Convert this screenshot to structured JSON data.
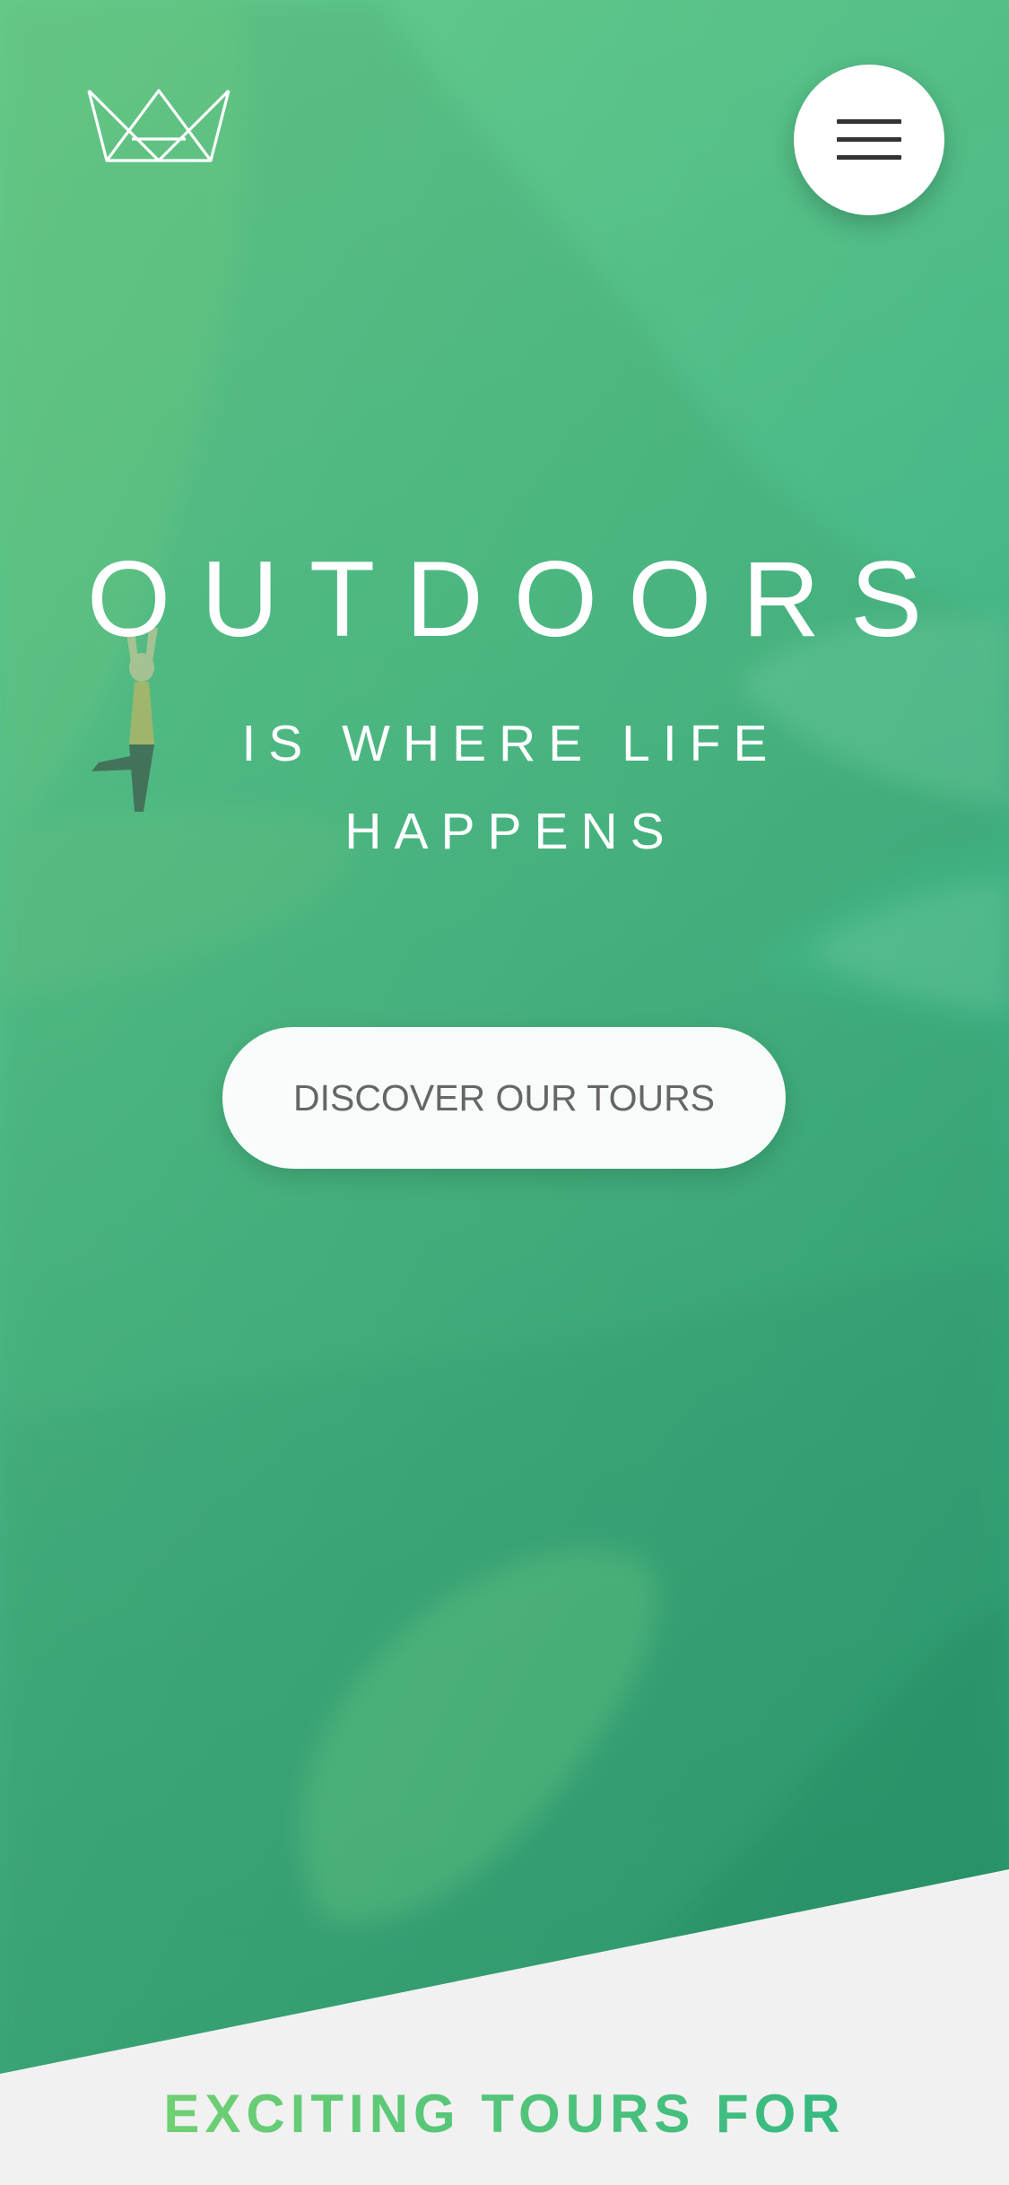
{
  "hero": {
    "headline_main": "OUTDOORS",
    "headline_sub": "IS WHERE LIFE HAPPENS",
    "cta_label": "DISCOVER OUR TOURS"
  },
  "header": {
    "logo_icon": "crown-icon",
    "menu_icon": "hamburger-menu-icon"
  },
  "section": {
    "heading": "EXCITING TOURS FOR"
  },
  "colors": {
    "primary_light": "#7ed56f",
    "primary_dark": "#28b485",
    "background": "#f1f1f1",
    "cta_text": "#666666"
  }
}
